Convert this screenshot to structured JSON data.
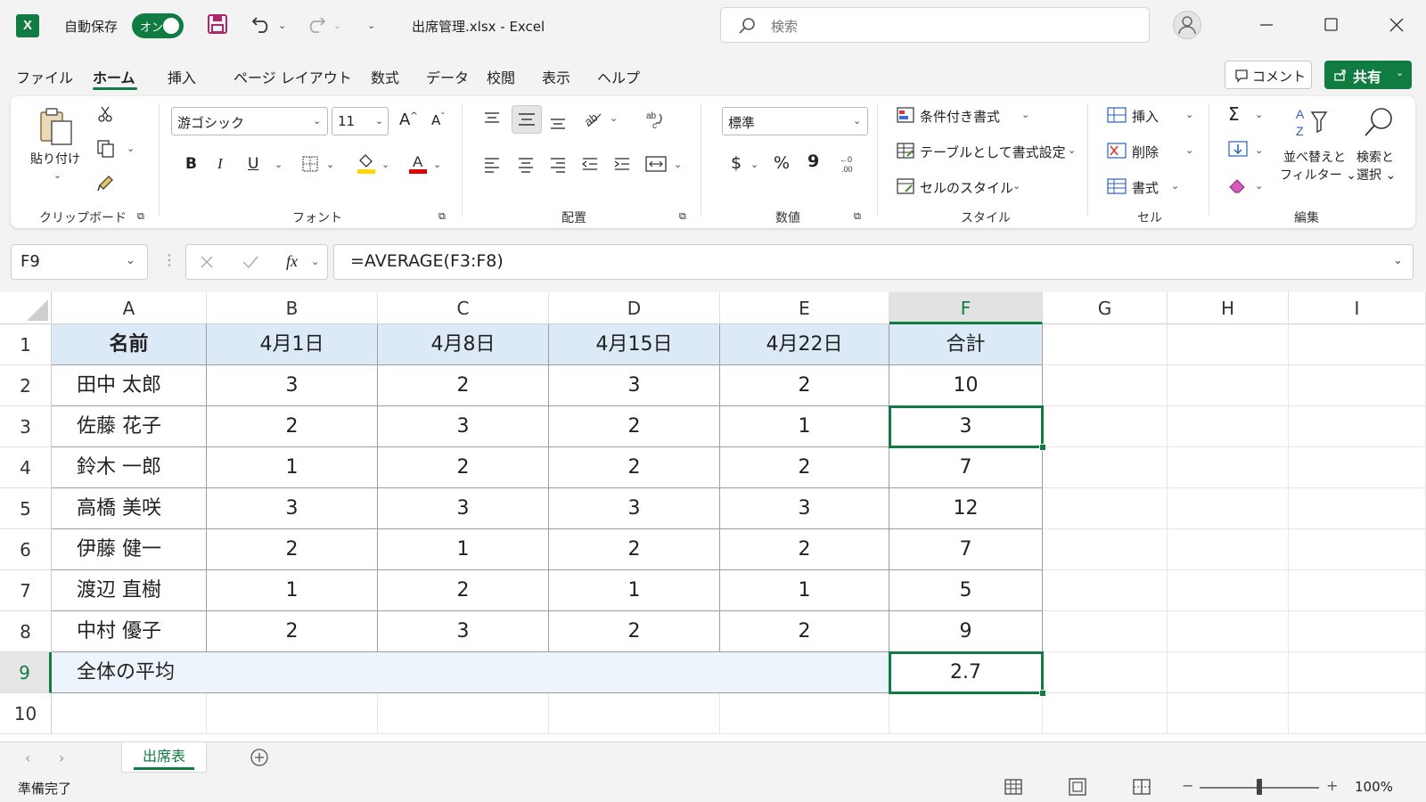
{
  "titlebar": {
    "app_icon": "X",
    "autosave_label": "自動保存",
    "autosave_state": "オン",
    "doc_title": "出席管理.xlsx  -  Excel",
    "search_placeholder": "検索"
  },
  "menu": {
    "tabs": [
      "ファイル",
      "ホーム",
      "挿入",
      "ページ レイアウト",
      "数式",
      "データ",
      "校閲",
      "表示",
      "ヘルプ"
    ],
    "active": "ホーム",
    "comment_label": "コメント",
    "share_label": "共有"
  },
  "ribbon": {
    "clipboard": {
      "paste": "貼り付け",
      "label": "クリップボード"
    },
    "font": {
      "name": "游ゴシック",
      "size": "11",
      "label": "フォント",
      "bold": "B",
      "italic": "I",
      "underline": "U",
      "grow": "A",
      "shrink": "A",
      "fill_color": "#ffd800",
      "font_color": "#e00000"
    },
    "alignment": {
      "label": "配置"
    },
    "number": {
      "format": "標準",
      "label": "数値",
      "currency": "$",
      "percent": "%",
      "comma": "9"
    },
    "styles": {
      "conditional": "条件付き書式",
      "table": "テーブルとして書式設定",
      "cell_styles": "セルのスタイル",
      "label": "スタイル"
    },
    "cells": {
      "insert": "挿入",
      "delete": "削除",
      "format": "書式",
      "label": "セル"
    },
    "editing": {
      "sum": "Σ",
      "sort1": "並べ替えと",
      "sort2": "フィルター",
      "find1": "検索と",
      "find2": "選択",
      "label": "編集"
    }
  },
  "formula_bar": {
    "name_box": "F9",
    "fx": "fx",
    "formula": "=AVERAGE(F3:F8)"
  },
  "grid": {
    "columns": [
      "A",
      "B",
      "C",
      "D",
      "E",
      "F",
      "G",
      "H",
      "I"
    ],
    "row_numbers": [
      "1",
      "2",
      "3",
      "4",
      "5",
      "6",
      "7",
      "8",
      "9",
      "10"
    ],
    "header": [
      "名前",
      "4月1日",
      "4月8日",
      "4月15日",
      "4月22日",
      "合計"
    ],
    "rows": [
      [
        "田中 太郎",
        "3",
        "2",
        "3",
        "2",
        "10"
      ],
      [
        "佐藤 花子",
        "2",
        "3",
        "2",
        "1",
        "3"
      ],
      [
        "鈴木 一郎",
        "1",
        "2",
        "2",
        "2",
        "7"
      ],
      [
        "高橋 美咲",
        "3",
        "3",
        "3",
        "3",
        "12"
      ],
      [
        "伊藤 健一",
        "2",
        "1",
        "2",
        "2",
        "7"
      ],
      [
        "渡辺 直樹",
        "1",
        "2",
        "1",
        "1",
        "5"
      ],
      [
        "中村 優子",
        "2",
        "3",
        "2",
        "2",
        "9"
      ]
    ],
    "average_label": "全体の平均",
    "average_value": "2.7",
    "accent": "#107c41",
    "header_fill": "#dce9f7"
  },
  "sheets": {
    "tabs": [
      "出席表"
    ],
    "active": "出席表"
  },
  "status": {
    "ready": "準備完了",
    "zoom": "100%"
  }
}
